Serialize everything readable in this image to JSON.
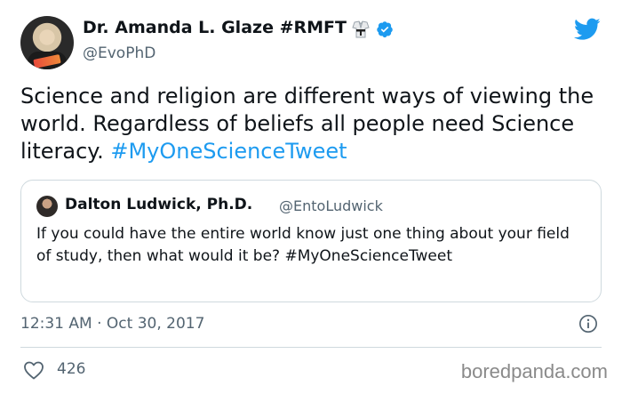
{
  "author": {
    "name": "Dr. Amanda L. Glaze #RMFT",
    "handle": "@EvoPhD",
    "verified": true,
    "name_emoji": "martial-arts-uniform-icon"
  },
  "tweet": {
    "text": "Science and religion are different ways of viewing the world. Regardless of beliefs all people need Science literacy. ",
    "hashtag": "#MyOneScienceTweet",
    "timestamp": "12:31 AM · Oct 30, 2017",
    "likes": "426"
  },
  "quoted_tweet": {
    "name": "Dalton Ludwick, Ph.D.",
    "handle": "@EntoLudwick",
    "text": "If you could have the entire world know just one thing about your field of study, then what would it be? #MyOneScienceTweet"
  },
  "watermark": "boredpanda.com",
  "colors": {
    "accent": "#1d9bf0",
    "secondary_text": "#536471",
    "border": "#cfd9de"
  }
}
